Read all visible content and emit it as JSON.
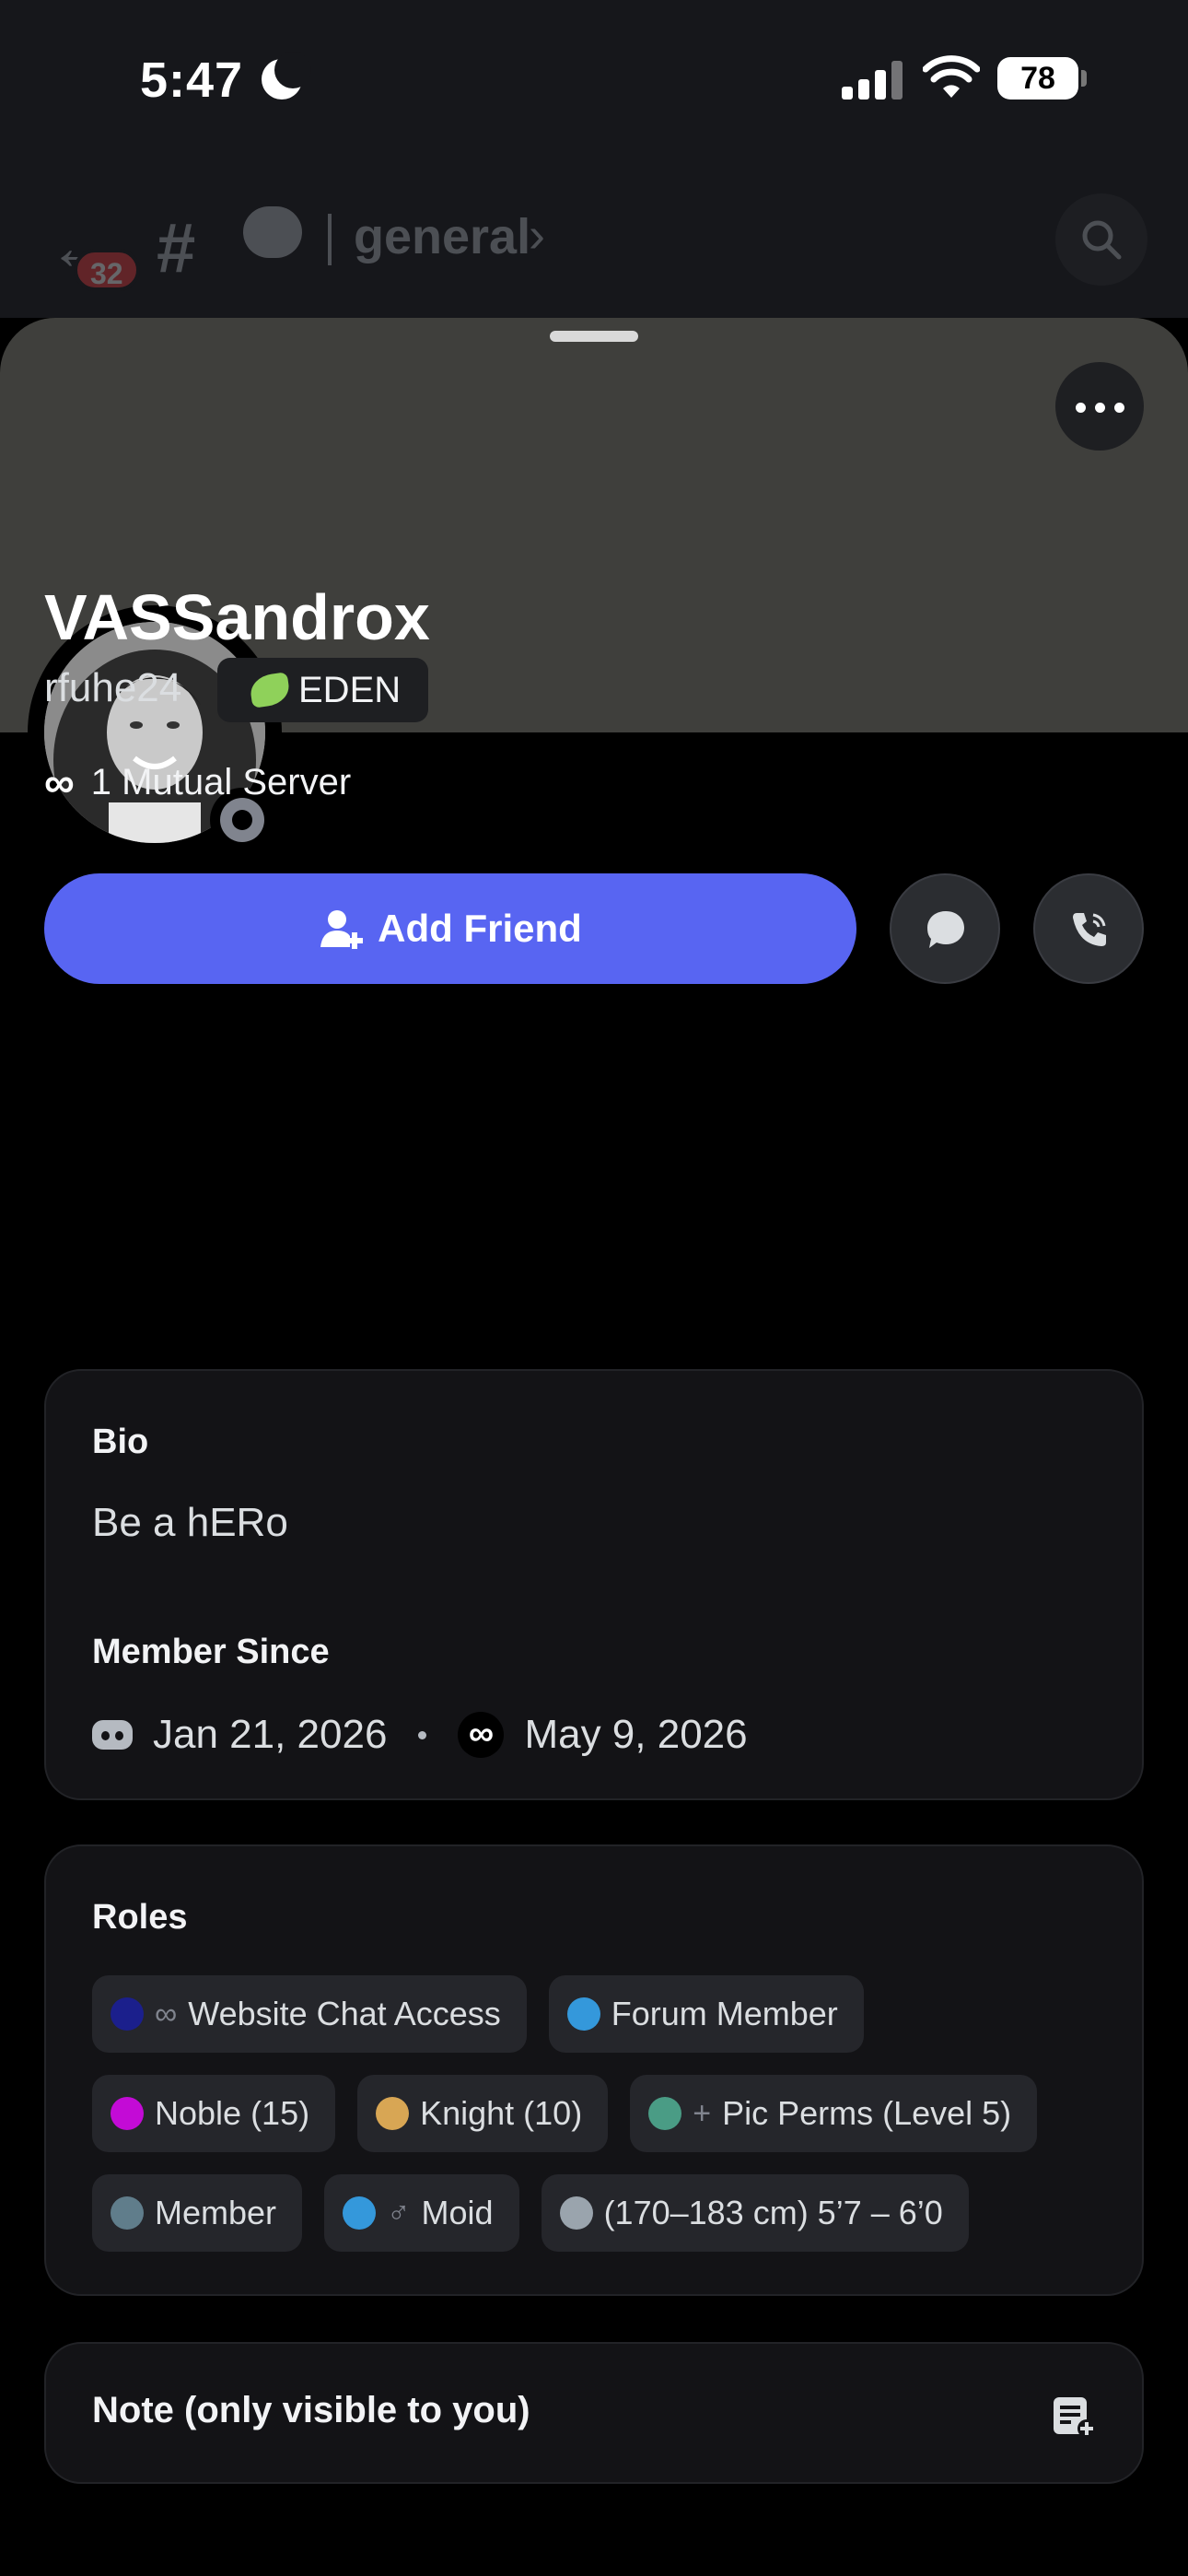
{
  "status_bar": {
    "time": "5:47",
    "battery": "78"
  },
  "header": {
    "unread_badge": "32",
    "channel": "general"
  },
  "profile": {
    "display_name": "VASSandrox",
    "username": "rfuhe24",
    "tag": "EDEN",
    "mutual_icon": "∞",
    "mutual_servers": "1 Mutual Server"
  },
  "actions": {
    "add_friend": "Add Friend"
  },
  "bio": {
    "title": "Bio",
    "text": "Be a hERo",
    "member_since_title": "Member Since",
    "discord_date": "Jan 21, 2026",
    "server_icon": "∞",
    "server_date": "May 9, 2026"
  },
  "roles": {
    "title": "Roles",
    "items": [
      {
        "color": "#1b1f8c",
        "glyph": "∞",
        "label": "Website Chat Access"
      },
      {
        "color": "#3498db",
        "glyph": "",
        "label": "Forum Member"
      },
      {
        "color": "#c30bd6",
        "glyph": "",
        "label": "Noble (15)"
      },
      {
        "color": "#d8a654",
        "glyph": "",
        "label": "Knight (10)"
      },
      {
        "color": "#4a9c85",
        "glyph": "+",
        "label": "Pic Perms (Level 5)"
      },
      {
        "color": "#607d8b",
        "glyph": "",
        "label": "Member"
      },
      {
        "color": "#3498db",
        "glyph": "♂",
        "label": "Moid"
      },
      {
        "color": "#9aa4ad",
        "glyph": "",
        "label": "(170–183 cm) 5’7 – 6’0"
      }
    ]
  },
  "note": {
    "label": "Note (only visible to you)"
  },
  "colors": {
    "accent": "#5865f2",
    "background": "#000000",
    "card": "#131316"
  }
}
